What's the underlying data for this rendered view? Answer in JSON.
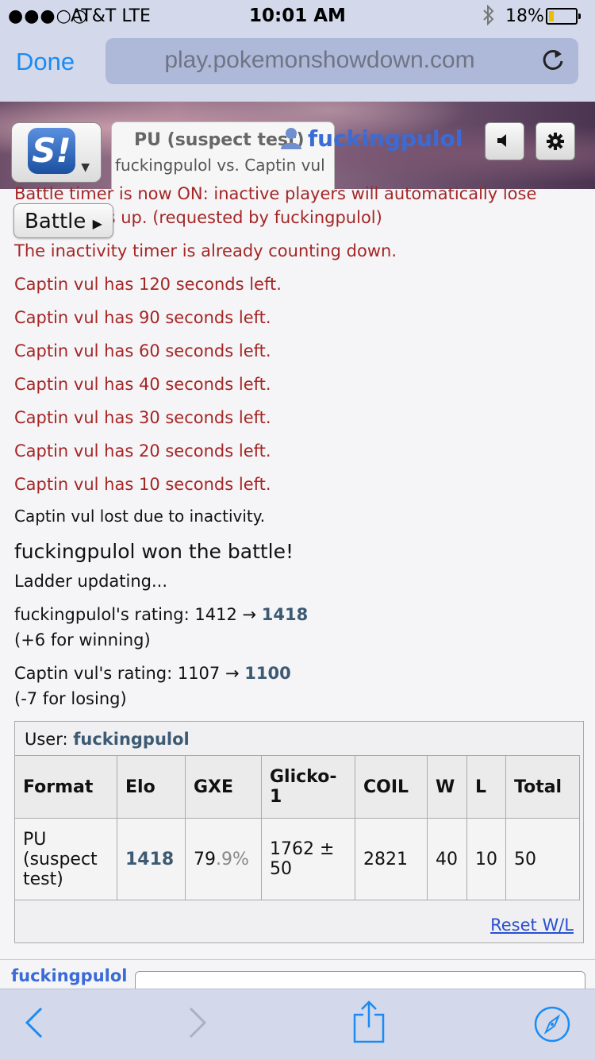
{
  "status": {
    "signal": "●●●○○",
    "carrier": "AT&T  LTE",
    "time": "10:01 AM",
    "bluetooth": "∗",
    "battery_pct": "18%",
    "battery_level": 0.18
  },
  "browser": {
    "done_label": "Done",
    "url": "play.pokemonshowdown.com"
  },
  "header": {
    "logo_letter": "S!",
    "tab_title": "PU (suspect test)",
    "tab_subtitle": "fuckingpulol vs. Captin vul",
    "username": "fuckingpulol"
  },
  "battle_button": "Battle",
  "log": {
    "partial_top_line": "Battle timer is now ON: inactive players will automatically lose",
    "partial_second_line": "when time's up. (requested by fuckingpulol)",
    "already": "The inactivity timer is already counting down.",
    "timers": [
      "Captin vul has 120 seconds left.",
      "Captin vul has 90 seconds left.",
      "Captin vul has 60 seconds left.",
      "Captin vul has 40 seconds left.",
      "Captin vul has 30 seconds left.",
      "Captin vul has 20 seconds left.",
      "Captin vul has 10 seconds left."
    ],
    "lost": "Captin vul lost due to inactivity.",
    "won": "fuckingpulol won the battle!",
    "ladder": "Ladder updating...",
    "rating1_prefix": "fuckingpulol's rating: 1412 → ",
    "rating1_new": "1418",
    "rating1_change": "(+6 for winning)",
    "rating2_prefix": "Captin vul's rating: 1107 → ",
    "rating2_new": "1100",
    "rating2_change": "(-7 for losing)"
  },
  "stats": {
    "user_label": "User: ",
    "user_name": "fuckingpulol",
    "headers": [
      "Format",
      "Elo",
      "GXE",
      "Glicko-1",
      "COIL",
      "W",
      "L",
      "Total"
    ],
    "row": {
      "format": "PU (suspect test)",
      "elo": "1418",
      "gxe_main": "79",
      "gxe_dec": ".9%",
      "glicko": "1762 ± 50",
      "coil": "2821",
      "w": "40",
      "l": "10",
      "total": "50"
    },
    "reset_label": "Reset W/L"
  },
  "chat": {
    "name": "fuckingpulol"
  },
  "colors": {
    "accent": "#1a8bf5",
    "log_red": "#a52626",
    "username_blue": "#3a6bd6",
    "rating_bold": "#3d5a73"
  }
}
